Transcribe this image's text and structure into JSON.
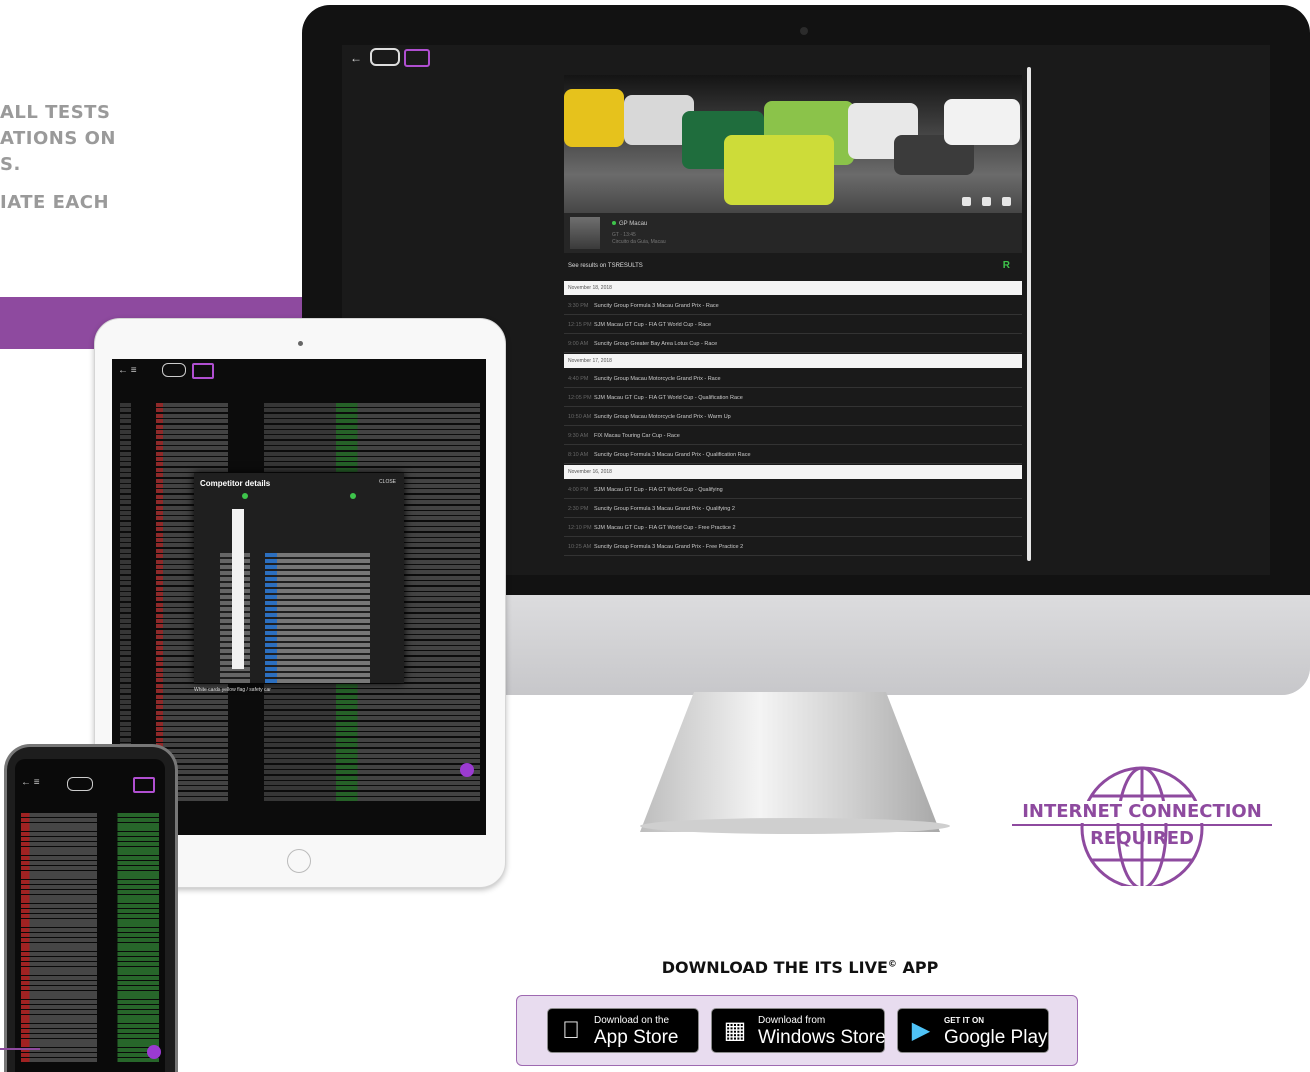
{
  "marketing": {
    "line1": "ALL TESTS",
    "line2": "ATIONS ON",
    "line3": "S.",
    "line4": "IATE EACH"
  },
  "desktop_app": {
    "back_icon": "arrow-left",
    "results_text": "See results on TSRESULTS",
    "event": {
      "name": "GP Macau",
      "meta": "GT · 13:45",
      "track": "Circuito da Guia, Macau"
    },
    "days": [
      {
        "date": "November 18, 2018",
        "sessions": [
          {
            "time": "3:30 PM",
            "title": "Suncity Group Formula 3 Macau Grand Prix - Race"
          },
          {
            "time": "12:15 PM",
            "title": "SJM Macau GT Cup - FIA GT World Cup - Race"
          },
          {
            "time": "9:00 AM",
            "title": "Suncity Group Greater Bay Area Lotus Cup - Race"
          }
        ]
      },
      {
        "date": "November 17, 2018",
        "sessions": [
          {
            "time": "4:40 PM",
            "title": "Suncity Group Macau Motorcycle Grand Prix - Race"
          },
          {
            "time": "12:05 PM",
            "title": "SJM Macau GT Cup - FIA GT World Cup - Qualification Race"
          },
          {
            "time": "10:50 AM",
            "title": "Suncity Group Macau Motorcycle Grand Prix - Warm Up"
          },
          {
            "time": "9:30 AM",
            "title": "FIX Macau Touring Car Cup - Race"
          },
          {
            "time": "8:10 AM",
            "title": "Suncity Group Formula 3 Macau Grand Prix - Qualification Race"
          }
        ]
      },
      {
        "date": "November 16, 2018",
        "sessions": [
          {
            "time": "4:00 PM",
            "title": "SJM Macau GT Cup - FIA GT World Cup - Qualifying"
          },
          {
            "time": "2:30 PM",
            "title": "Suncity Group Formula 3 Macau Grand Prix - Qualifying 2"
          },
          {
            "time": "12:10 PM",
            "title": "SJM Macau GT Cup - FIA GT World Cup - Free Practice 2"
          },
          {
            "time": "10:25 AM",
            "title": "Suncity Group Formula 3 Macau Grand Prix - Free Practice 2"
          }
        ]
      }
    ]
  },
  "tablet_app": {
    "modal_title": "Competitor details",
    "modal_close": "CLOSE",
    "footer_note": "White cards yellow flag / safety car"
  },
  "badge": {
    "line1": "INTERNET CONNECTION",
    "line2": "REQUIRED",
    "color": "#8e4a9f"
  },
  "download": {
    "title": "DOWNLOAD THE ITS LIVE",
    "title_mark": "©",
    "title_suffix": " APP",
    "stores": [
      {
        "small": "Download on the",
        "big": "App Store",
        "icon": "apple-icon"
      },
      {
        "small": "Download from",
        "big": "Windows Store",
        "icon": "windows-store-icon"
      },
      {
        "small": "GET IT ON",
        "big": "Google Play",
        "icon": "google-play-icon"
      }
    ]
  }
}
